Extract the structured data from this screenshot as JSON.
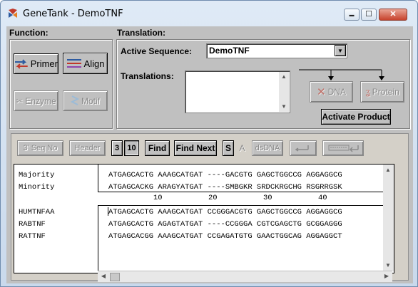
{
  "window": {
    "title": "GeneTank - DemoTNF",
    "controls": {
      "minimize": "▬",
      "maximize": "☐",
      "close": "✕"
    }
  },
  "function_panel": {
    "label": "Function:",
    "buttons": [
      {
        "label": "Primer",
        "enabled": true
      },
      {
        "label": "Align",
        "enabled": true
      },
      {
        "label": "Enzyme",
        "enabled": false
      },
      {
        "label": "Motif",
        "enabled": false
      }
    ]
  },
  "translation_panel": {
    "label": "Translation:",
    "active_sequence_label": "Active Sequence:",
    "active_sequence_value": "DemoTNF",
    "translations_label": "Translations:",
    "dna_button": "DNA",
    "protein_button": "Protein",
    "activate_product_button": "Activate Product"
  },
  "toolbar": {
    "seq_no": "3' Seq No",
    "header": "Header",
    "three": "3",
    "ten": "10",
    "find": "Find",
    "find_next": "Find Next",
    "s": "S",
    "a": "A",
    "dsdna": "dsDNA"
  },
  "alignment": {
    "consensus_rows": [
      {
        "name": "Majority",
        "seq": "ATGAGCACTG AAAGCATGAT ----GACGTG GAGCTGGCCG AGGAGGCG"
      },
      {
        "name": "Minority",
        "seq": "ATGAGCACKG ARAGYATGAT ----SMBGKR SRDCKRGCHG RSGRRGSK"
      }
    ],
    "ruler_ticks": [
      "10",
      "20",
      "30",
      "40"
    ],
    "sequences": [
      {
        "name": "HUMTNFAA",
        "seq": "ATGAGCACTG AAAGCATGAT CCGGGACGTG GAGCTGGCCG AGGAGGCG"
      },
      {
        "name": "RABTNF",
        "seq": "ATGAGCACTG AGAGTATGAT ----CCGGGA CGTCGAGCTG GCGGAGGG"
      },
      {
        "name": "RATTNF",
        "seq": "ATGAGCACGG AAAGCATGAT CCGAGATGTG GAACTGGCAG AGGAGGCT"
      }
    ]
  },
  "colors": {
    "window_bg": "#c0c0c0",
    "title_bar": "#dfeaf6",
    "close_button": "#c7422c"
  }
}
